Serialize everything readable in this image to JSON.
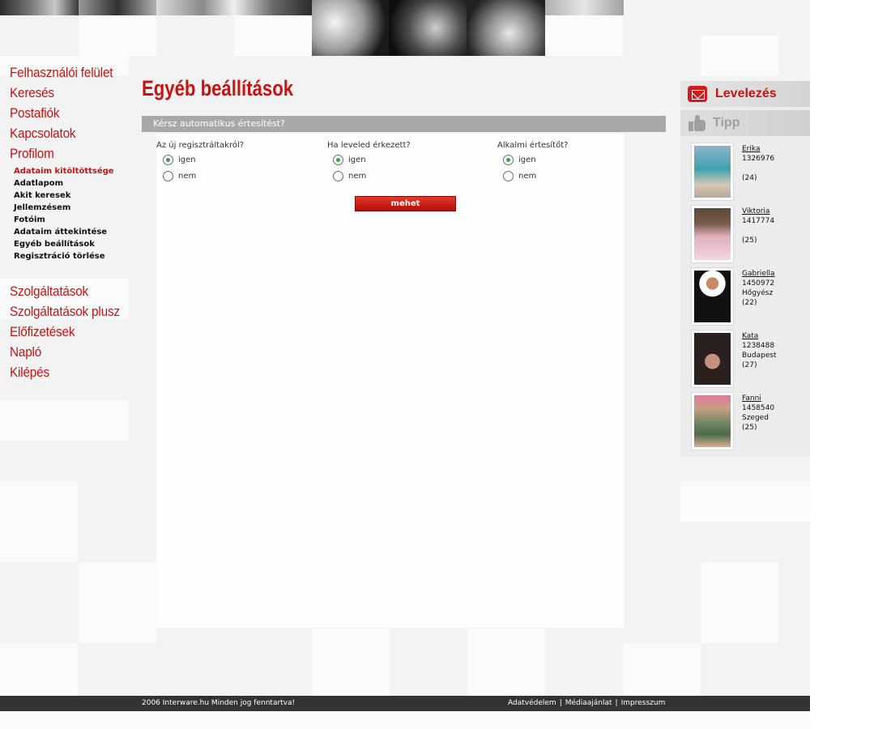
{
  "left_nav": {
    "main_top": [
      "Felhasználói felület",
      "Keresés",
      "Postafiók",
      "Kapcsolatok",
      "Profilom"
    ],
    "profile_submenu": [
      "Adataim kitöltöttsége",
      "Adatlapom",
      "Akit keresek",
      "Jellemzésem",
      "Fotóim",
      "Adataim áttekintése",
      "Egyéb beállítások",
      "Regisztráció törlése"
    ],
    "main_bottom": [
      "Szolgáltatások",
      "Szolgáltatások plusz",
      "Előfizetések",
      "Napló",
      "Kilépés"
    ]
  },
  "page": {
    "title": "Egyéb beállítások",
    "section_title": "Kérsz automatikus értesítést?"
  },
  "questions": [
    {
      "label": "Az új regisztráltakról?",
      "options": [
        "igen",
        "nem"
      ],
      "selected": "igen"
    },
    {
      "label": "Ha leveled érkezett?",
      "options": [
        "igen",
        "nem"
      ],
      "selected": "igen"
    },
    {
      "label": "Alkalmi értesítőt?",
      "options": [
        "igen",
        "nem"
      ],
      "selected": "igen"
    }
  ],
  "submit_label": "mehet",
  "sidebar": {
    "mail_tab": "Levelezés",
    "tip_tab": "Tipp",
    "profiles": [
      {
        "name": "Erika",
        "id": "1326976",
        "city": "",
        "age": "(24)"
      },
      {
        "name": "Viktoria",
        "id": "1417774",
        "city": "",
        "age": "(25)"
      },
      {
        "name": "Gabriella",
        "id": "1450972",
        "city": "Hőgyész",
        "age": "(22)"
      },
      {
        "name": "Kata",
        "id": "1238488",
        "city": "Budapest",
        "age": "(27)"
      },
      {
        "name": "Fanni",
        "id": "1458540",
        "city": "Szeged",
        "age": "(25)"
      }
    ]
  },
  "footer": {
    "copyright": "2006 Interware.hu Minden jog fenntartva!",
    "links": [
      "Adatvédelem",
      "Médiaajánlat",
      "Impresszum"
    ],
    "separator": "|"
  },
  "colors": {
    "accent_red": "#cc1111",
    "section_gray": "#a8a8a8",
    "footer_dark": "#333333"
  }
}
